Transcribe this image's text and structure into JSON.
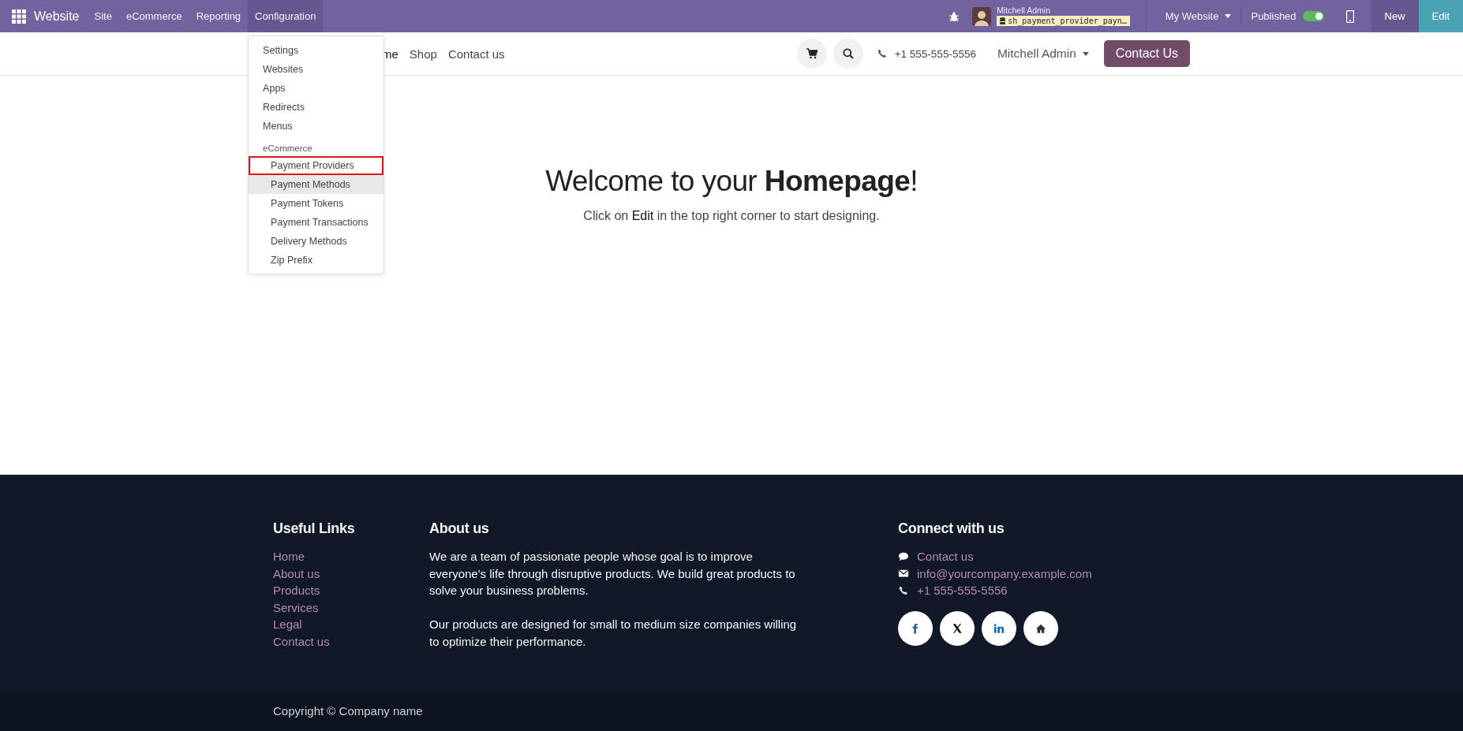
{
  "topbar": {
    "app_name": "Website",
    "menus": [
      {
        "label": "Site",
        "open": false
      },
      {
        "label": "eCommerce",
        "open": false
      },
      {
        "label": "Reporting",
        "open": false
      },
      {
        "label": "Configuration",
        "open": true
      }
    ],
    "user": {
      "name": "Mitchell Admin",
      "database": "sh_payment_provider_payn…"
    },
    "website_selector": "My Website",
    "published": {
      "label": "Published",
      "on": true
    },
    "buttons": [
      {
        "label": "New",
        "kind": "new"
      },
      {
        "label": "Edit",
        "kind": "edit"
      }
    ]
  },
  "config_menu": {
    "groups": [
      {
        "items": [
          {
            "label": "Settings",
            "hovered": false,
            "outlined": false
          },
          {
            "label": "Websites",
            "hovered": false,
            "outlined": false
          },
          {
            "label": "Apps",
            "hovered": false,
            "outlined": false
          },
          {
            "label": "Redirects",
            "hovered": false,
            "outlined": false
          },
          {
            "label": "Menus",
            "hovered": false,
            "outlined": false
          }
        ]
      },
      {
        "header": "eCommerce",
        "items": [
          {
            "label": "Payment Providers",
            "hovered": false,
            "outlined": true
          },
          {
            "label": "Payment Methods",
            "hovered": true,
            "outlined": false
          },
          {
            "label": "Payment Tokens",
            "hovered": false,
            "outlined": false
          },
          {
            "label": "Payment Transactions",
            "hovered": false,
            "outlined": false
          },
          {
            "label": "Delivery Methods",
            "hovered": false,
            "outlined": false
          },
          {
            "label": "Zip Prefix",
            "hovered": false,
            "outlined": false
          }
        ]
      }
    ]
  },
  "site_header": {
    "nav": [
      "me",
      "Shop",
      "Contact us"
    ],
    "phone": "+1 555-555-5556",
    "user": "Mitchell Admin",
    "cta": "Contact Us"
  },
  "hero": {
    "title": "Welcome to your **Homepage**!",
    "subtitle": "Click on **Edit** in the top right corner to start designing."
  },
  "footer": {
    "useful_links": {
      "title": "Useful Links",
      "links": [
        "Home",
        "About us",
        "Products",
        "Services",
        "Legal",
        "Contact us"
      ]
    },
    "about": {
      "title": "About us",
      "paragraphs": [
        "We are a team of passionate people whose goal is to improve everyone's life through disruptive products. We build great products to solve your business problems.",
        "Our products are designed for small to medium size companies willing to optimize their performance."
      ]
    },
    "connect": {
      "title": "Connect with us",
      "items": [
        {
          "kind": "chat",
          "text": "Contact us"
        },
        {
          "kind": "email",
          "text": "info@yourcompany.example.com"
        },
        {
          "kind": "phone",
          "text": "+1 555-555-5556"
        }
      ],
      "socials": [
        {
          "kind": "f"
        },
        {
          "kind": "x"
        },
        {
          "kind": "in"
        },
        {
          "kind": "home"
        }
      ]
    }
  },
  "copyright": "Copyright © Company name"
}
